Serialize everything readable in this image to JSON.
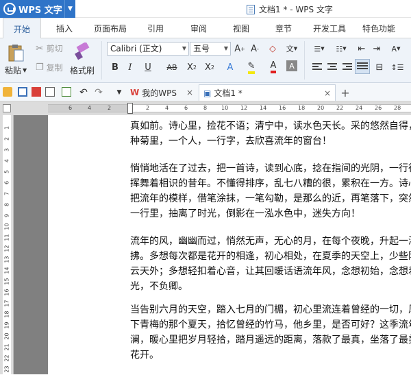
{
  "app": {
    "name": "WPS 文字",
    "window_title": "文档1 * - WPS 文字"
  },
  "menu_tabs": [
    "开始",
    "插入",
    "页面布局",
    "引用",
    "审阅",
    "视图",
    "章节",
    "开发工具",
    "特色功能"
  ],
  "ribbon": {
    "paste": "粘贴",
    "cut": "剪切",
    "copy": "复制",
    "format_painter": "格式刷",
    "font_name": "Calibri (正文)",
    "font_size": "五号"
  },
  "doc_tabs": [
    {
      "label": "我的WPS"
    },
    {
      "label": "文档1 *"
    }
  ],
  "ruler": {
    "h_ticks": [
      "6",
      "4",
      "2",
      "2",
      "4",
      "6",
      "8",
      "10",
      "12",
      "14",
      "16",
      "18",
      "20",
      "22",
      "24",
      "26",
      "28"
    ],
    "v_ticks": [
      "1",
      "2",
      "3",
      "4",
      "5",
      "6",
      "7",
      "8",
      "9",
      "10",
      "11",
      "12",
      "13",
      "14",
      "15",
      "16",
      "17",
      "18",
      "19",
      "20",
      "21",
      "22",
      "23"
    ]
  },
  "document": {
    "paragraphs": [
      [
        "真如前。诗心里，捡花不语；清宁中，读水色天长。采的悠然自得，",
        "种菊里，一个人，一行字，去欣喜流年的窗台！"
      ],
      [
        "悄悄地活在了过去，把一首诗，读到心底，捻在指间的光阴，一行行",
        "挥舞着相识的昔年。不懂得排序，乱七八糟的很，累积在一方。诗心里",
        "把流年的模样，借笔涂抹，一笔勾勒，是那么的近，再笔落下，突然",
        "一行里，抽离了时光，倒影在一泓水色中，迷失方向！"
      ],
      [
        "流年的风，幽幽而过，悄然无声，无心的月，在每个夜晚，升起一泓",
        "拂。多想每次都是花开的相逢，初心相处，在夏季的天空上，少些阴",
        "云天外；多想轻扣着心音，让其回暖话语流年风，念想初始，念想着",
        "光，不负卿。"
      ],
      [
        "当告别六月的天空，踏入七月的门楣，初心里流连着曾经的一切，风",
        "下青梅的那个夏天，拾忆曾经的竹马，他乡里，是否可好？这季流年",
        "澜，暖心里把岁月轻拾，踏月遥远的距离，落款了最真，坐落了最美",
        "花开。"
      ]
    ]
  }
}
